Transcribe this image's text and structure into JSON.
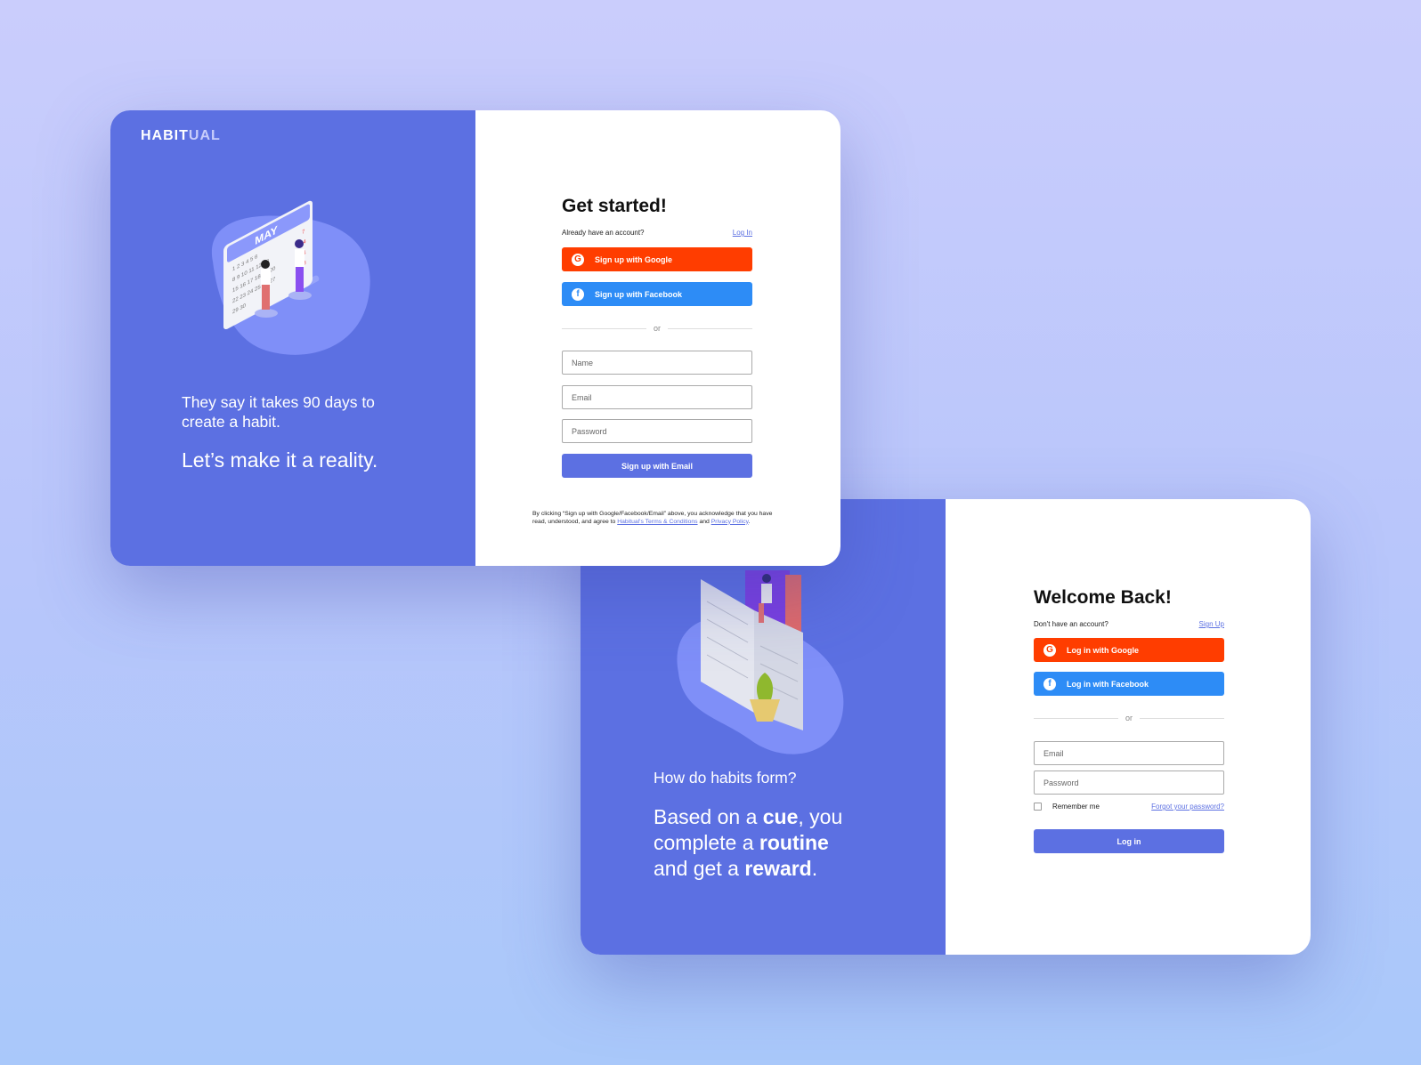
{
  "brand": {
    "logo_main": "HABIT",
    "logo_accent": "UAL"
  },
  "signup": {
    "tagline": "They say it takes 90 days to create a habit.",
    "headline": "Let’s make it a reality.",
    "calendar_month": "MAY",
    "title": "Get started!",
    "have_account": "Already have an account?",
    "login_link": "Log In",
    "google": "Sign up with Google",
    "facebook": "Sign up with Facebook",
    "or": "or",
    "name_placeholder": "Name",
    "email_placeholder": "Email",
    "password_placeholder": "Password",
    "email_button": "Sign up with Email",
    "terms_pre": "By clicking “Sign up with Google/Facebook/Email” above, you acknowledge that you have read, understood, and agree to ",
    "terms_link": "Habitual's Terms & Conditions",
    "terms_and": " and ",
    "privacy_link": "Privacy Policy",
    "terms_end": "."
  },
  "login": {
    "question": "How do habits form?",
    "s1": "Based on a ",
    "cue": "cue",
    "s2": ", you complete a ",
    "routine": "routine",
    "s3": " and get a ",
    "reward": "reward",
    "s4": ".",
    "title": "Welcome Back!",
    "no_account": "Don't have an account?",
    "signup_link": "Sign Up",
    "google": "Log in with Google",
    "facebook": "Log in with Facebook",
    "or": "or",
    "email_placeholder": "Email",
    "password_placeholder": "Password",
    "remember": "Remember me",
    "forgot": "Forgot your password?",
    "login_button": "Log in"
  },
  "colors": {
    "accent": "#5c70e2",
    "google": "#ff3d00",
    "facebook": "#2d8cf6"
  },
  "icons": {
    "google": "google-icon",
    "facebook": "facebook-icon"
  }
}
